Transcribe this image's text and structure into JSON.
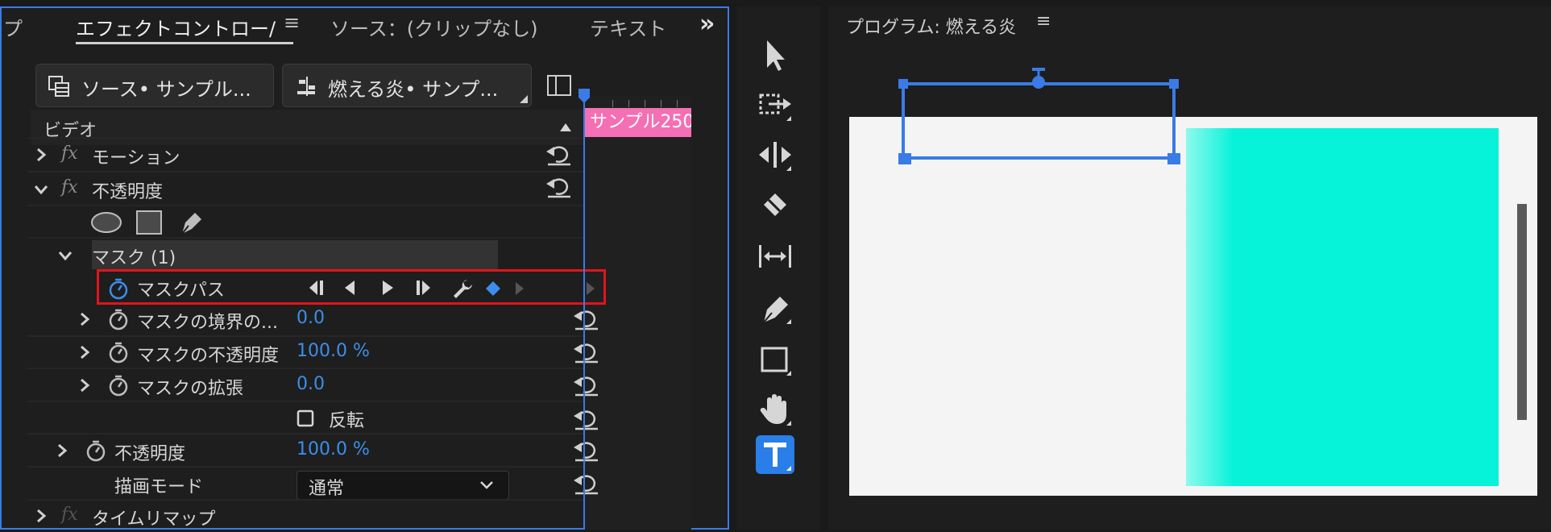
{
  "effect_panel": {
    "tabs": [
      {
        "label": "プ"
      },
      {
        "label": "エフェクトコントロー/",
        "active": true
      },
      {
        "label": "ソース：(クリップなし)"
      },
      {
        "label": "テキスト"
      }
    ],
    "menu_glyph": "≡",
    "overflow_glyph": "»",
    "source_button": "ソース• サンプル...",
    "sequence_button": "燃える炎• サンプ...",
    "section_video": "ビデオ",
    "clip_label": "サンプル250",
    "rows": {
      "motion": "モーション",
      "opacity": "不透明度",
      "mask": "マスク (1)",
      "mask_path": "マスクパス",
      "mask_feather": "マスクの境界の...",
      "mask_feather_value": "0.0",
      "mask_opacity": "マスクの不透明度",
      "mask_opacity_value": "100.0 %",
      "mask_expansion": "マスクの拡張",
      "mask_expansion_value": "0.0",
      "inverted": "反転",
      "opacity_prop": "不透明度",
      "opacity_prop_value": "100.0 %",
      "blend_mode": "描画モード",
      "blend_mode_value": "通常",
      "time_remap": "タイムリマップ"
    },
    "fx_glyph": "fx"
  },
  "program_panel": {
    "title": "プログラム: 燃える炎",
    "menu_glyph": "≡"
  },
  "colors": {
    "accent": "#3a7be6",
    "value_blue": "#3d8ee9",
    "highlight_box": "#e0151b",
    "clip_pink": "#f46fb3",
    "cyan_frame": "#06f2d9",
    "canvas_white": "#f4f4f4"
  },
  "tools": [
    "selection-tool-icon",
    "track-select-forward-icon",
    "ripple-edit-icon",
    "razor-icon",
    "slip-icon",
    "pen-icon",
    "rectangle-icon",
    "hand-icon",
    "type-icon"
  ]
}
